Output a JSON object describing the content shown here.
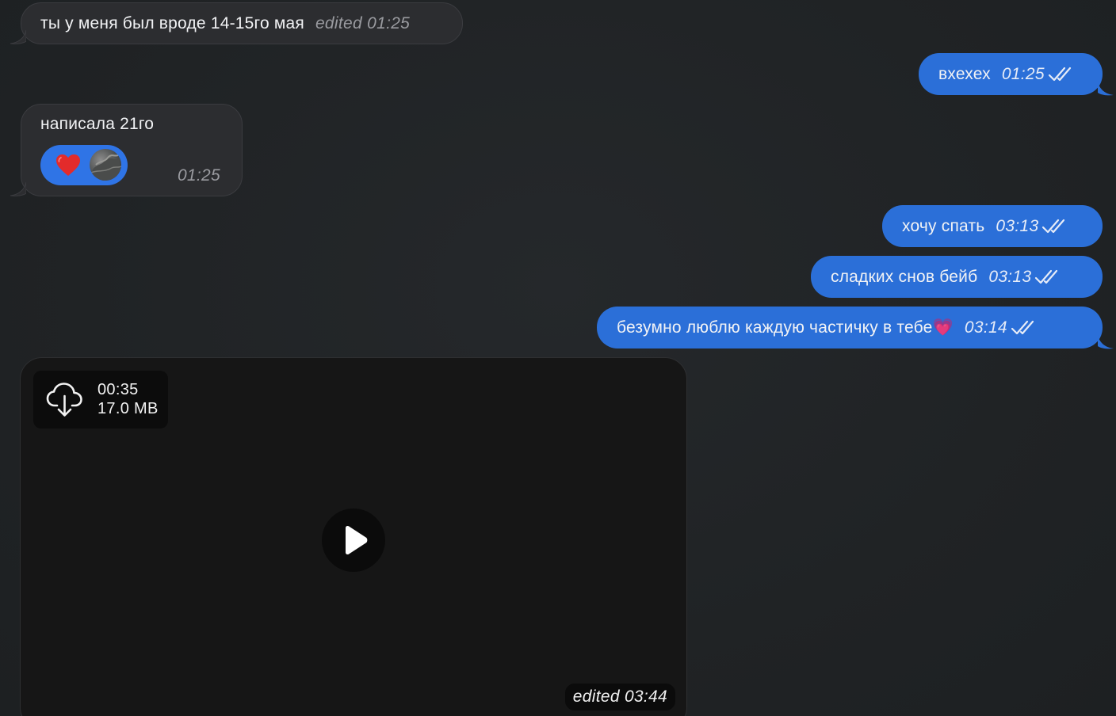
{
  "messages": [
    {
      "id": "m1",
      "direction": "incoming",
      "text": "ты у меня был вроде 14-15го мая",
      "meta": "edited 01:25"
    },
    {
      "id": "m2",
      "direction": "outgoing",
      "text": "вхехех",
      "time": "01:25",
      "status": "read"
    },
    {
      "id": "m3",
      "direction": "incoming",
      "text": "написала 21го",
      "time": "01:25",
      "reaction": {
        "emoji": "❤️",
        "icon": "heart-icon"
      }
    },
    {
      "id": "m4",
      "direction": "outgoing",
      "text": "хочу спать",
      "time": "03:13",
      "status": "read"
    },
    {
      "id": "m5",
      "direction": "outgoing",
      "text": "сладких снов бейб",
      "time": "03:13",
      "status": "read"
    },
    {
      "id": "m6",
      "direction": "outgoing",
      "text": "безумно люблю каждую частичку в тебе💗",
      "time": "03:14",
      "status": "read"
    }
  ],
  "video": {
    "duration": "00:35",
    "size": "17.0 MB",
    "meta": "edited 03:44",
    "download_icon": "cloud-download-icon",
    "play_icon": "play-icon"
  },
  "colors": {
    "background": "#212426",
    "incoming_bubble": "#2c2d30",
    "outgoing_bubble": "#2b6fd8",
    "reaction": "#2f74e6"
  }
}
